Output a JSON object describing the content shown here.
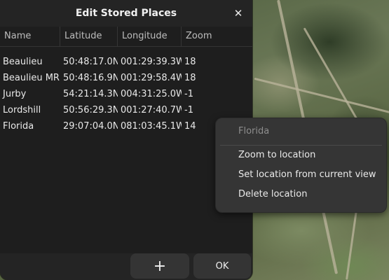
{
  "dialog": {
    "title": "Edit Stored Places",
    "close_icon": "close-icon",
    "columns": [
      "Name",
      "Latitude",
      "Longitude",
      "Zoom"
    ],
    "rows": [
      {
        "name": "Beaulieu",
        "lat": "50:48:17.0N",
        "lon": "001:29:39.3W",
        "zoom": "18"
      },
      {
        "name": "Beaulieu MR",
        "lat": "50:48:16.9N",
        "lon": "001:29:58.4W",
        "zoom": "18"
      },
      {
        "name": "Jurby",
        "lat": "54:21:14.3N",
        "lon": "004:31:25.0W",
        "zoom": "-1"
      },
      {
        "name": "Lordshill",
        "lat": "50:56:29.3N",
        "lon": "001:27:40.7W",
        "zoom": "-1"
      },
      {
        "name": "Florida",
        "lat": "29:07:04.0N",
        "lon": "081:03:45.1W",
        "zoom": "14"
      }
    ],
    "add_button_label": "+",
    "ok_button_label": "OK"
  },
  "context_menu": {
    "header": "Florida",
    "items": [
      "Zoom to location",
      "Set location from current view",
      "Delete location"
    ]
  }
}
